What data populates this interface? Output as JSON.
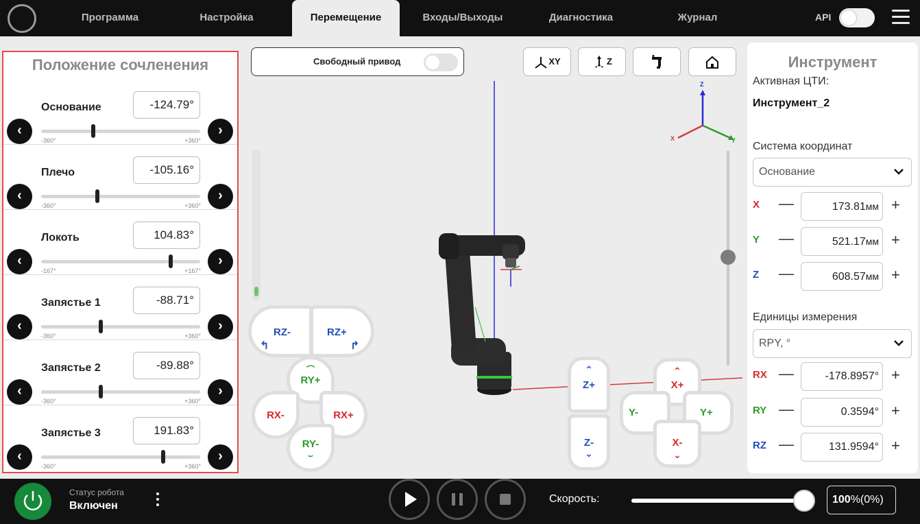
{
  "header": {
    "tabs": [
      {
        "label": "Программа"
      },
      {
        "label": "Настройка"
      },
      {
        "label": "Перемещение"
      },
      {
        "label": "Входы/Выходы"
      },
      {
        "label": "Диагностика"
      },
      {
        "label": "Журнал"
      }
    ],
    "active_tab": "Перемещение",
    "api_label": "API"
  },
  "joint_panel": {
    "title": "Положение сочленения",
    "joints": [
      {
        "name": "Основание",
        "value": "-124.79°",
        "min": "-360°",
        "max": "+360°",
        "position": 0.327
      },
      {
        "name": "Плечо",
        "value": "-105.16°",
        "min": "-360°",
        "max": "+360°",
        "position": 0.354
      },
      {
        "name": "Локоть",
        "value": "104.83°",
        "min": "-167°",
        "max": "+167°",
        "position": 0.814
      },
      {
        "name": "Запястье 1",
        "value": "-88.71°",
        "min": "-360°",
        "max": "+360°",
        "position": 0.377
      },
      {
        "name": "Запястье 2",
        "value": "-89.88°",
        "min": "-360°",
        "max": "+360°",
        "position": 0.375
      },
      {
        "name": "Запястье 3",
        "value": "191.83°",
        "min": "-360°",
        "max": "+360°",
        "position": 0.766
      }
    ]
  },
  "viewport": {
    "free_drive_label": "Свободный привод",
    "view_buttons": [
      "XY",
      "Z"
    ],
    "axis_labels": {
      "x": "X",
      "y": "Y",
      "z": "Z"
    },
    "jog": {
      "rz_minus": "RZ-",
      "rz_plus": "RZ+",
      "ry_plus": "RY+",
      "ry_minus": "RY-",
      "rx_minus": "RX-",
      "rx_plus": "RX+",
      "z_plus": "Z+",
      "z_minus": "Z-",
      "x_plus": "X+",
      "x_minus": "X-",
      "y_minus": "Y-",
      "y_plus": "Y+"
    }
  },
  "tool_panel": {
    "title": "Инструмент",
    "active_tcp_label": "Активная ЦТИ:",
    "active_tcp_value": "Инструмент_2",
    "coord_system_label": "Система координат",
    "coord_system_value": "Основание",
    "position": [
      {
        "axis": "X",
        "value": "173.81",
        "unit": "мм"
      },
      {
        "axis": "Y",
        "value": "521.17",
        "unit": "мм"
      },
      {
        "axis": "Z",
        "value": "608.57",
        "unit": "мм"
      }
    ],
    "units_label": "Единицы измерения",
    "units_value": "RPY, °",
    "orientation": [
      {
        "axis": "RX",
        "value": "-178.8957°"
      },
      {
        "axis": "RY",
        "value": "0.3594°"
      },
      {
        "axis": "RZ",
        "value": "131.9594°"
      }
    ],
    "minus_symbol": "—",
    "plus_symbol": "+"
  },
  "bottom_bar": {
    "status_label": "Статус робота",
    "status_value": "Включен",
    "speed_label": "Скорость:",
    "speed_value": "100",
    "speed_suffix": "%(0%)",
    "speed_fraction": 1.0
  },
  "colors": {
    "topbar": "#111111",
    "power": "#16893a",
    "highlight_border": "#e64a4a",
    "x_axis": "#d9262b",
    "y_axis": "#2c9b2c",
    "z_axis": "#1f4fb5"
  }
}
